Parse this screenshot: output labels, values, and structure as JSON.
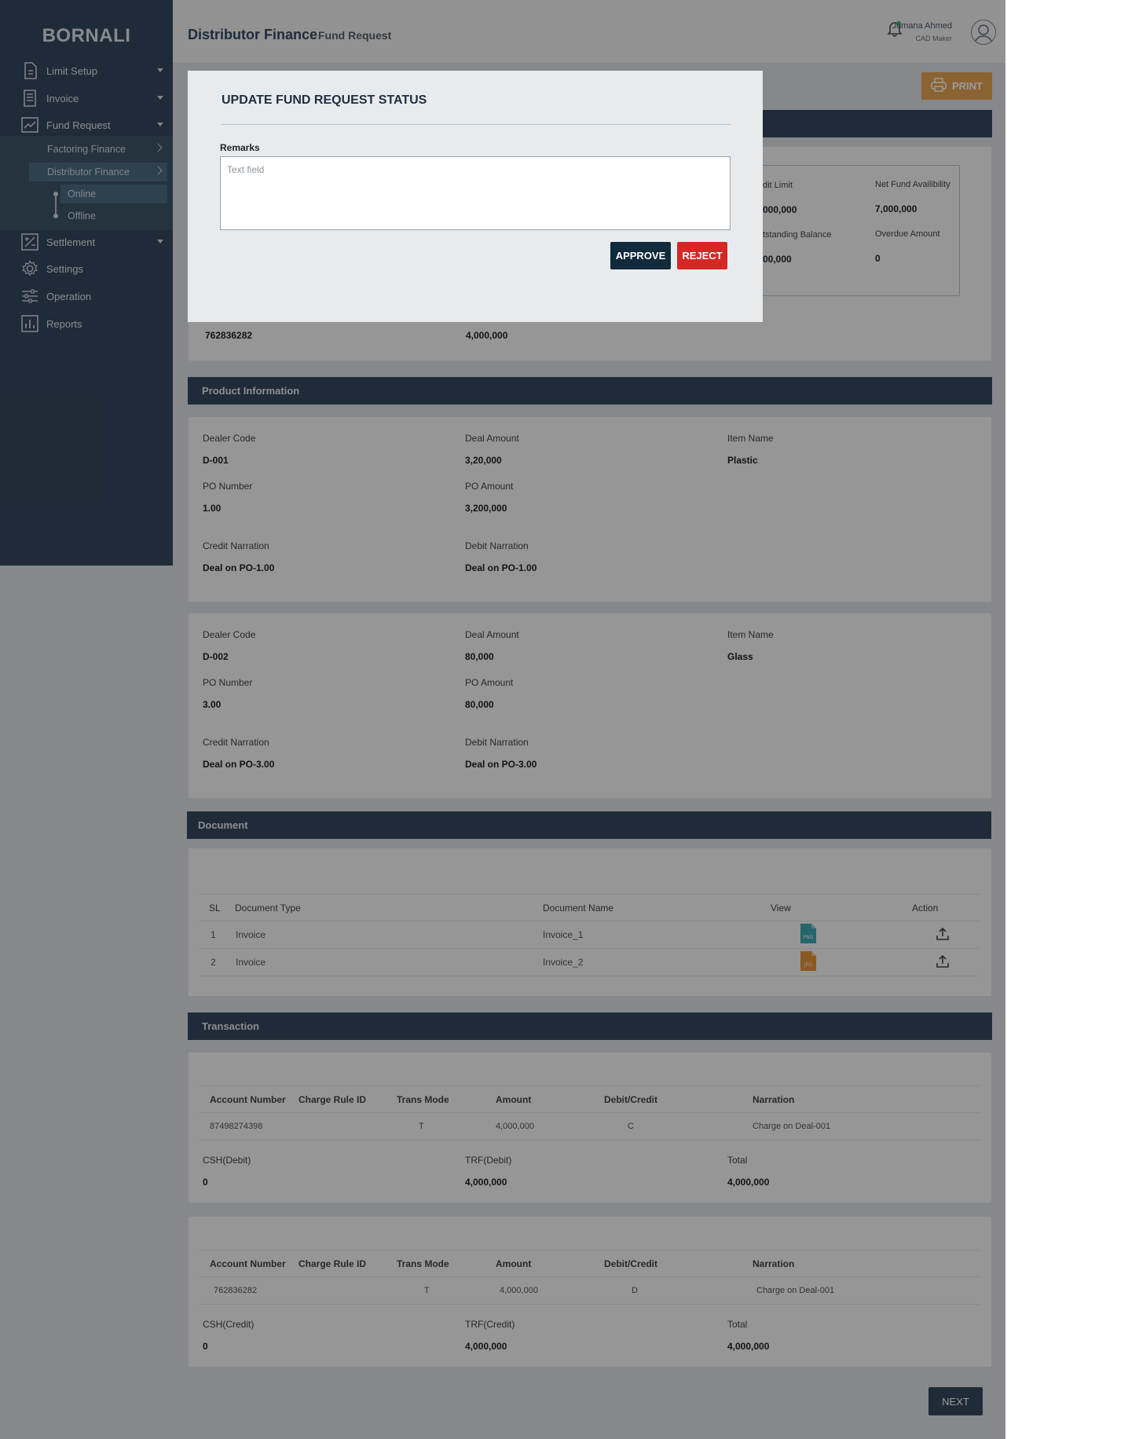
{
  "sidebar": {
    "brand": "BORNALI",
    "items": [
      {
        "label": "Limit Setup",
        "icon": "document-icon"
      },
      {
        "label": "Invoice",
        "icon": "invoice-icon"
      },
      {
        "label": "Fund Request",
        "icon": "trend-chart-icon"
      },
      {
        "label": "Settlement",
        "icon": "settlement-icon"
      },
      {
        "label": "Settings",
        "icon": "gear-icon"
      },
      {
        "label": "Operation",
        "icon": "sliders-icon"
      },
      {
        "label": "Reports",
        "icon": "bar-chart-icon"
      }
    ],
    "sub_items": [
      {
        "label": "Factoring Finance"
      },
      {
        "label": "Distributor Finance"
      }
    ],
    "leaves": [
      {
        "label": "Online"
      },
      {
        "label": "Offline"
      }
    ]
  },
  "header": {
    "title": "Distributor Finance",
    "subtitle": "Fund Request",
    "user_name": "Jumana Ahmed",
    "user_role": "CAD Maker"
  },
  "print_label": "PRINT",
  "summary": {
    "credit_limit_label": "dit Limit",
    "credit_limit_value": "000,000",
    "net_fund_label": "Net Fund Availibility",
    "net_fund_value": "7,000,000",
    "outstanding_label": "tstanding Balance",
    "outstanding_value": "00,000",
    "overdue_label": "Overdue Amount",
    "overdue_value": "0",
    "account_value": "762836282",
    "amount_value": "4,000,000"
  },
  "product": {
    "section_title": "Product Information",
    "cards": [
      {
        "dealer_code_label": "Dealer Code",
        "dealer_code": "D-001",
        "deal_amount_label": "Deal Amount",
        "deal_amount": "3,20,000",
        "item_name_label": "Item Name",
        "item_name": "Plastic",
        "po_number_label": "PO Number",
        "po_number": "1.00",
        "po_amount_label": "PO Amount",
        "po_amount": "3,200,000",
        "credit_narration_label": "Credit Narration",
        "credit_narration": "Deal on PO-1.00",
        "debit_narration_label": "Debit Narration",
        "debit_narration": "Deal on PO-1.00"
      },
      {
        "dealer_code_label": "Dealer Code",
        "dealer_code": "D-002",
        "deal_amount_label": "Deal Amount",
        "deal_amount": "80,000",
        "item_name_label": "Item Name",
        "item_name": "Glass",
        "po_number_label": "PO Number",
        "po_number": "3.00",
        "po_amount_label": "PO Amount",
        "po_amount": "80,000",
        "credit_narration_label": "Credit Narration",
        "credit_narration": "Deal on PO-3.00",
        "debit_narration_label": "Debit Narration",
        "debit_narration": "Deal on PO-3.00"
      }
    ]
  },
  "document": {
    "section_title": "Document",
    "columns": [
      "SL",
      "Document Type",
      "Document Name",
      "View",
      "Action"
    ],
    "rows": [
      {
        "sl": "1",
        "type": "Invoice",
        "name": "Invoice_1",
        "file_badge": "PNG",
        "file_color": "#3fa9b5"
      },
      {
        "sl": "2",
        "type": "Invoice",
        "name": "Invoice_2",
        "file_badge": "JPG",
        "file_color": "#e8933a"
      }
    ]
  },
  "transaction": {
    "section_title": "Transaction",
    "columns": [
      "Account Number",
      "Charge Rule ID",
      "Trans Mode",
      "Amount",
      "Debit/Credit",
      "Narration"
    ],
    "blocks": [
      {
        "row": {
          "account": "87498274398",
          "charge_rule": "",
          "mode": "T",
          "amount": "4,000,000",
          "dc": "C",
          "narration": "Charge on Deal-001"
        },
        "csh_label": "CSH(Debit)",
        "csh_value": "0",
        "trf_label": "TRF(Debit)",
        "trf_value": "4,000,000",
        "total_label": "Total",
        "total_value": "4,000,000"
      },
      {
        "row": {
          "account": "762836282",
          "charge_rule": "",
          "mode": "T",
          "amount": "4,000,000",
          "dc": "D",
          "narration": "Charge on Deal-001"
        },
        "csh_label": "CSH(Credit)",
        "csh_value": "0",
        "trf_label": "TRF(Credit)",
        "trf_value": "4,000,000",
        "total_label": "Total",
        "total_value": "4,000,000"
      }
    ]
  },
  "next_label": "NEXT",
  "modal": {
    "title": "UPDATE FUND REQUEST STATUS",
    "remarks_label": "Remarks",
    "remarks_placeholder": "Text field",
    "remarks_value": "",
    "approve_label": "APPROVE",
    "reject_label": "REJECT"
  },
  "colors": {
    "sidebar": "#34495e",
    "print": "#e8a654",
    "approve": "#112a3c",
    "reject": "#d62727"
  }
}
